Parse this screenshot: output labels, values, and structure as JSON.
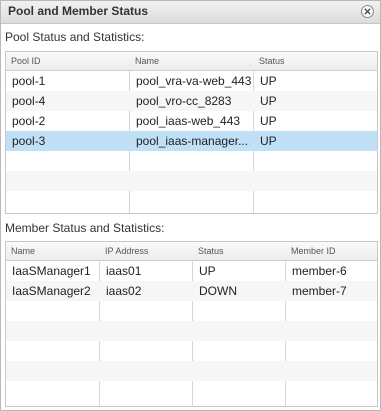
{
  "dialog": {
    "title": "Pool and Member Status",
    "close_icon": "close-icon"
  },
  "pool_section": {
    "label": "Pool Status and Statistics:",
    "columns": [
      "Pool ID",
      "Name",
      "Status"
    ],
    "rows": [
      {
        "id": "pool-1",
        "name": "pool_vra-va-web_443",
        "status": "UP"
      },
      {
        "id": "pool-4",
        "name": "pool_vro-cc_8283",
        "status": "UP"
      },
      {
        "id": "pool-2",
        "name": "pool_iaas-web_443",
        "status": "UP"
      },
      {
        "id": "pool-3",
        "name": "pool_iaas-manager...",
        "status": "UP"
      }
    ],
    "selected_index": 3
  },
  "member_section": {
    "label": "Member Status and Statistics:",
    "columns": [
      "Name",
      "IP Address",
      "Status",
      "Member ID"
    ],
    "rows": [
      {
        "name": "IaaSManager1",
        "ip": "iaas01",
        "status": "UP",
        "member_id": "member-6"
      },
      {
        "name": "IaaSManager2",
        "ip": "iaas02",
        "status": "DOWN",
        "member_id": "member-7"
      }
    ]
  },
  "colors": {
    "selected_row": "#bfe0f7",
    "header_bg": "#ececec"
  }
}
